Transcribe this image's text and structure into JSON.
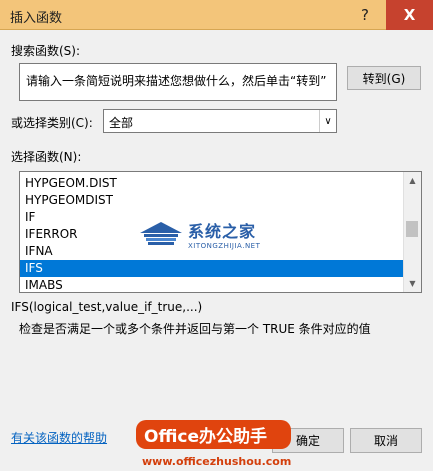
{
  "window": {
    "title": "插入函数",
    "help_label": "?",
    "close_label": "X"
  },
  "search": {
    "label": "搜索函数(S):",
    "value": "请输入一条简短说明来描述您想做什么，然后单击“转到”",
    "go_button": "转到(G)"
  },
  "category": {
    "label": "或选择类别(C):",
    "selected": "全部",
    "arrow": "∨"
  },
  "functions": {
    "label": "选择函数(N):",
    "items": [
      "HYPGEOM.DIST",
      "HYPGEOMDIST",
      "IF",
      "IFERROR",
      "IFNA",
      "IFS",
      "IMABS"
    ],
    "selected_index": 5
  },
  "details": {
    "signature": "IFS(logical_test,value_if_true,...)",
    "description": "检查是否满足一个或多个条件并返回与第一个 TRUE 条件对应的值"
  },
  "footer": {
    "help_link": "有关该函数的帮助",
    "ok_button": "确定",
    "cancel_button": "取消"
  },
  "watermarks": {
    "site1_name": "系统之家",
    "site1_url": "XITONGZHIJIA.NET",
    "site2_name": "Office办公助手",
    "site2_url": "www.officezhushou.com"
  },
  "colors": {
    "titlebar": "#f3c57a",
    "close": "#c6422e",
    "selection": "#0078d7",
    "link": "#0563c1"
  }
}
